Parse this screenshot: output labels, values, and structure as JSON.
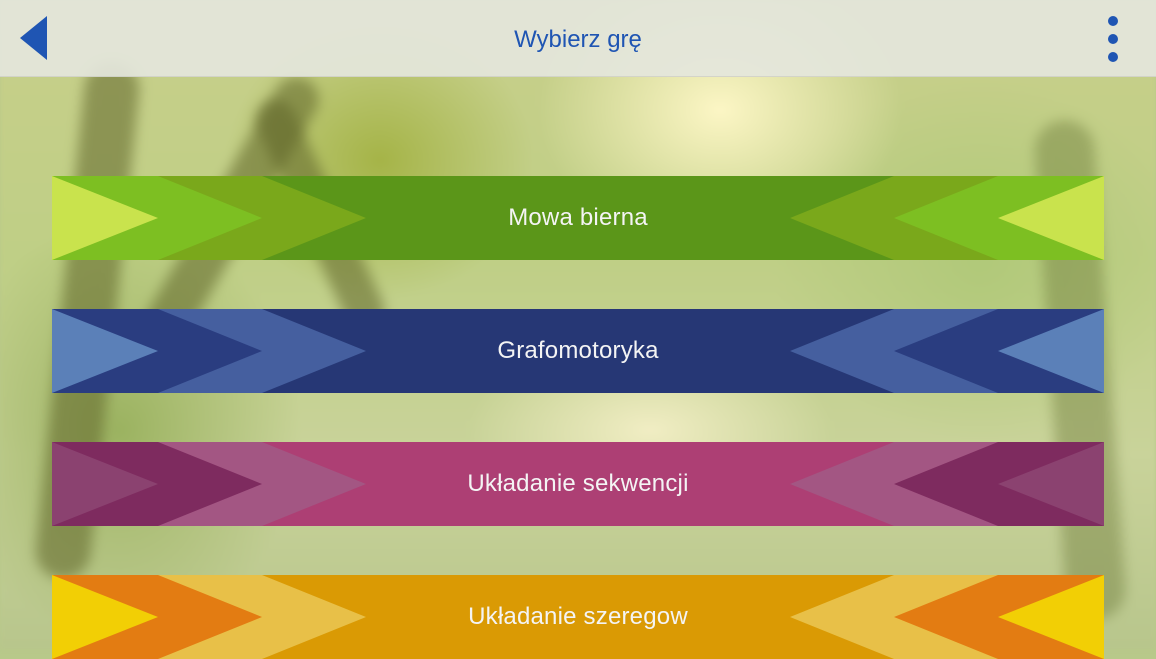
{
  "header": {
    "title": "Wybierz grę",
    "back_icon": "chevron-left-icon",
    "menu_icon": "more-vertical-icon",
    "accent": "#1f55b3"
  },
  "games": [
    {
      "label": "Mowa bierna",
      "colors": [
        "#c9e34d",
        "#7dbf22",
        "#7aa81b",
        "#5b9619"
      ]
    },
    {
      "label": "Grafomotoryka",
      "colors": [
        "#5b80b8",
        "#2a3d80",
        "#455f9f",
        "#263775"
      ]
    },
    {
      "label": "Układanie sekwencji",
      "colors": [
        "#8b4270",
        "#7e2b5f",
        "#a35683",
        "#ad3f74"
      ]
    },
    {
      "label": "Układanie szeregow",
      "colors": [
        "#f2cf05",
        "#e37c12",
        "#e8c048",
        "#da9a04"
      ]
    }
  ]
}
